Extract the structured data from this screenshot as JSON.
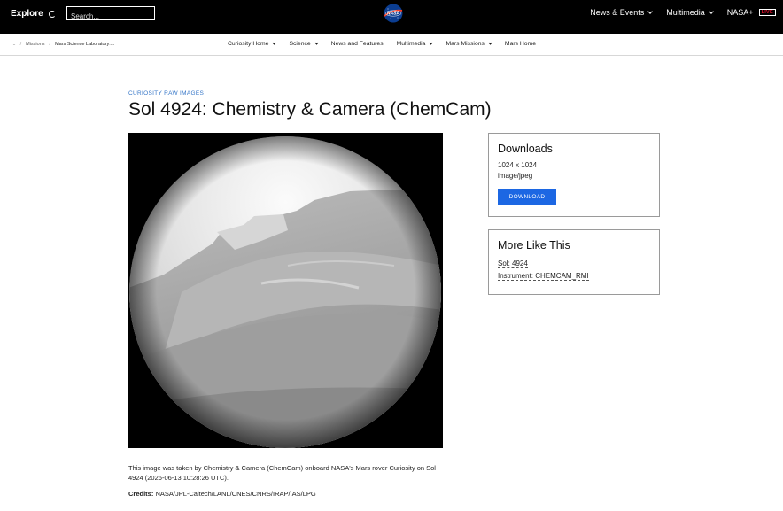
{
  "topbar": {
    "explore_label": "Explore",
    "search_placeholder": "Search...",
    "nav": [
      {
        "label": "News & Events"
      },
      {
        "label": "Multimedia"
      }
    ],
    "nasa_plus_label": "NASA+",
    "live_badge": "LIVE"
  },
  "breadcrumbs": {
    "ellipsis": "...",
    "sep": "/",
    "missions": "Missions",
    "current": "Mars Science Laboratory:..."
  },
  "subnav": [
    {
      "label": "Curiosity Home",
      "dropdown": true
    },
    {
      "label": "Science",
      "dropdown": true
    },
    {
      "label": "News and Features",
      "dropdown": false
    },
    {
      "label": "Multimedia",
      "dropdown": true
    },
    {
      "label": "Mars Missions",
      "dropdown": true
    },
    {
      "label": "Mars Home",
      "dropdown": false
    }
  ],
  "page": {
    "eyebrow": "CURIOSITY RAW IMAGES",
    "title": "Sol 4924: Chemistry & Camera (ChemCam)",
    "caption": "This image was taken by Chemistry & Camera (ChemCam) onboard NASA's Mars rover Curiosity on Sol 4924 (2026-06-13 10:28:26 UTC).",
    "credits_label": "Credits:",
    "credits_value": "NASA/JPL-Caltech/LANL/CNES/CNRS/IRAP/IAS/LPG"
  },
  "downloads": {
    "heading": "Downloads",
    "dimensions": "1024 x 1024",
    "mime": "image/jpeg",
    "button_label": "DOWNLOAD"
  },
  "more_like_this": {
    "heading": "More Like This",
    "sol_link": "Sol: 4924",
    "instrument_link": "Instrument: CHEMCAM_RMI"
  },
  "colors": {
    "accent_blue": "#1c67e3",
    "eyebrow_blue": "#3475c7",
    "live_red": "#e8102f",
    "topbar_bg": "#000000"
  }
}
